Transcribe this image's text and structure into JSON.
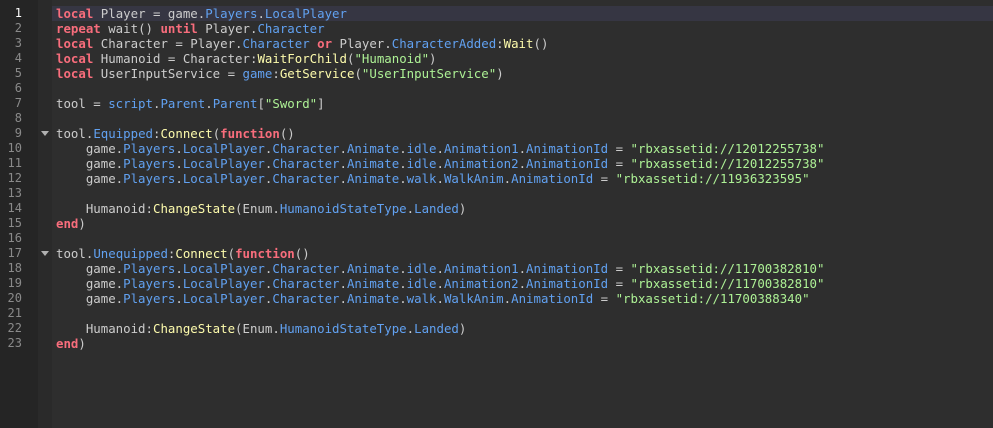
{
  "editor": {
    "current_line": 1,
    "colors": {
      "background": "#2e2e2e",
      "gutter": "#252525",
      "keyword": "#f86d7c",
      "identifier": "#cccccc",
      "property": "#61a1f1",
      "method": "#fdfbac",
      "string": "#adf195",
      "current_line": "#363643"
    },
    "lines": [
      {
        "num": "1",
        "tokens": [
          [
            "kw",
            "local"
          ],
          [
            "id",
            " Player = game."
          ],
          [
            "prop",
            "Players"
          ],
          [
            "id",
            "."
          ],
          [
            "prop",
            "LocalPlayer"
          ]
        ]
      },
      {
        "num": "2",
        "tokens": [
          [
            "kw",
            "repeat"
          ],
          [
            "id",
            " wait() "
          ],
          [
            "kw",
            "until"
          ],
          [
            "id",
            " Player."
          ],
          [
            "prop",
            "Character"
          ]
        ]
      },
      {
        "num": "3",
        "tokens": [
          [
            "kw",
            "local"
          ],
          [
            "id",
            " Character = Player."
          ],
          [
            "prop",
            "Character"
          ],
          [
            "id",
            " "
          ],
          [
            "kw",
            "or"
          ],
          [
            "id",
            " Player."
          ],
          [
            "prop",
            "CharacterAdded"
          ],
          [
            "id",
            ":"
          ],
          [
            "meth",
            "Wait"
          ],
          [
            "id",
            "()"
          ]
        ]
      },
      {
        "num": "4",
        "tokens": [
          [
            "kw",
            "local"
          ],
          [
            "id",
            " Humanoid = Character:"
          ],
          [
            "meth",
            "WaitForChild"
          ],
          [
            "id",
            "("
          ],
          [
            "str",
            "\"Humanoid\""
          ],
          [
            "id",
            ")"
          ]
        ]
      },
      {
        "num": "5",
        "tokens": [
          [
            "kw",
            "local"
          ],
          [
            "id",
            " UserInputService = "
          ],
          [
            "prop",
            "game"
          ],
          [
            "id",
            ":"
          ],
          [
            "meth",
            "GetService"
          ],
          [
            "id",
            "("
          ],
          [
            "str",
            "\"UserInputService\""
          ],
          [
            "id",
            ")"
          ]
        ]
      },
      {
        "num": "6",
        "tokens": []
      },
      {
        "num": "7",
        "tokens": [
          [
            "id",
            "tool = "
          ],
          [
            "prop",
            "script"
          ],
          [
            "id",
            "."
          ],
          [
            "prop",
            "Parent"
          ],
          [
            "id",
            "."
          ],
          [
            "prop",
            "Parent"
          ],
          [
            "id",
            "["
          ],
          [
            "str",
            "\"Sword\""
          ],
          [
            "id",
            "]"
          ]
        ]
      },
      {
        "num": "8",
        "tokens": []
      },
      {
        "num": "9",
        "fold": true,
        "tokens": [
          [
            "id",
            "tool."
          ],
          [
            "prop",
            "Equipped"
          ],
          [
            "id",
            ":"
          ],
          [
            "meth",
            "Connect"
          ],
          [
            "id",
            "("
          ],
          [
            "kw",
            "function"
          ],
          [
            "id",
            "()"
          ]
        ]
      },
      {
        "num": "10",
        "tokens": [
          [
            "id",
            "    game."
          ],
          [
            "prop",
            "Players"
          ],
          [
            "id",
            "."
          ],
          [
            "prop",
            "LocalPlayer"
          ],
          [
            "id",
            "."
          ],
          [
            "prop",
            "Character"
          ],
          [
            "id",
            "."
          ],
          [
            "prop",
            "Animate"
          ],
          [
            "id",
            "."
          ],
          [
            "prop",
            "idle"
          ],
          [
            "id",
            "."
          ],
          [
            "prop",
            "Animation1"
          ],
          [
            "id",
            "."
          ],
          [
            "prop",
            "AnimationId"
          ],
          [
            "id",
            " = "
          ],
          [
            "str",
            "\"rbxassetid://12012255738\""
          ]
        ]
      },
      {
        "num": "11",
        "tokens": [
          [
            "id",
            "    game."
          ],
          [
            "prop",
            "Players"
          ],
          [
            "id",
            "."
          ],
          [
            "prop",
            "LocalPlayer"
          ],
          [
            "id",
            "."
          ],
          [
            "prop",
            "Character"
          ],
          [
            "id",
            "."
          ],
          [
            "prop",
            "Animate"
          ],
          [
            "id",
            "."
          ],
          [
            "prop",
            "idle"
          ],
          [
            "id",
            "."
          ],
          [
            "prop",
            "Animation2"
          ],
          [
            "id",
            "."
          ],
          [
            "prop",
            "AnimationId"
          ],
          [
            "id",
            " = "
          ],
          [
            "str",
            "\"rbxassetid://12012255738\""
          ]
        ]
      },
      {
        "num": "12",
        "tokens": [
          [
            "id",
            "    game."
          ],
          [
            "prop",
            "Players"
          ],
          [
            "id",
            "."
          ],
          [
            "prop",
            "LocalPlayer"
          ],
          [
            "id",
            "."
          ],
          [
            "prop",
            "Character"
          ],
          [
            "id",
            "."
          ],
          [
            "prop",
            "Animate"
          ],
          [
            "id",
            "."
          ],
          [
            "prop",
            "walk"
          ],
          [
            "id",
            "."
          ],
          [
            "prop",
            "WalkAnim"
          ],
          [
            "id",
            "."
          ],
          [
            "prop",
            "AnimationId"
          ],
          [
            "id",
            " = "
          ],
          [
            "str",
            "\"rbxassetid://11936323595\""
          ]
        ]
      },
      {
        "num": "13",
        "tokens": []
      },
      {
        "num": "14",
        "tokens": [
          [
            "id",
            "    Humanoid:"
          ],
          [
            "meth",
            "ChangeState"
          ],
          [
            "id",
            "(Enum."
          ],
          [
            "prop",
            "HumanoidStateType"
          ],
          [
            "id",
            "."
          ],
          [
            "prop",
            "Landed"
          ],
          [
            "id",
            ")"
          ]
        ]
      },
      {
        "num": "15",
        "tokens": [
          [
            "kw",
            "end"
          ],
          [
            "id",
            ")"
          ]
        ]
      },
      {
        "num": "16",
        "tokens": []
      },
      {
        "num": "17",
        "fold": true,
        "tokens": [
          [
            "id",
            "tool."
          ],
          [
            "prop",
            "Unequipped"
          ],
          [
            "id",
            ":"
          ],
          [
            "meth",
            "Connect"
          ],
          [
            "id",
            "("
          ],
          [
            "kw",
            "function"
          ],
          [
            "id",
            "()"
          ]
        ]
      },
      {
        "num": "18",
        "tokens": [
          [
            "id",
            "    game."
          ],
          [
            "prop",
            "Players"
          ],
          [
            "id",
            "."
          ],
          [
            "prop",
            "LocalPlayer"
          ],
          [
            "id",
            "."
          ],
          [
            "prop",
            "Character"
          ],
          [
            "id",
            "."
          ],
          [
            "prop",
            "Animate"
          ],
          [
            "id",
            "."
          ],
          [
            "prop",
            "idle"
          ],
          [
            "id",
            "."
          ],
          [
            "prop",
            "Animation1"
          ],
          [
            "id",
            "."
          ],
          [
            "prop",
            "AnimationId"
          ],
          [
            "id",
            " = "
          ],
          [
            "str",
            "\"rbxassetid://11700382810\""
          ]
        ]
      },
      {
        "num": "19",
        "tokens": [
          [
            "id",
            "    game."
          ],
          [
            "prop",
            "Players"
          ],
          [
            "id",
            "."
          ],
          [
            "prop",
            "LocalPlayer"
          ],
          [
            "id",
            "."
          ],
          [
            "prop",
            "Character"
          ],
          [
            "id",
            "."
          ],
          [
            "prop",
            "Animate"
          ],
          [
            "id",
            "."
          ],
          [
            "prop",
            "idle"
          ],
          [
            "id",
            "."
          ],
          [
            "prop",
            "Animation2"
          ],
          [
            "id",
            "."
          ],
          [
            "prop",
            "AnimationId"
          ],
          [
            "id",
            " = "
          ],
          [
            "str",
            "\"rbxassetid://11700382810\""
          ]
        ]
      },
      {
        "num": "20",
        "tokens": [
          [
            "id",
            "    game."
          ],
          [
            "prop",
            "Players"
          ],
          [
            "id",
            "."
          ],
          [
            "prop",
            "LocalPlayer"
          ],
          [
            "id",
            "."
          ],
          [
            "prop",
            "Character"
          ],
          [
            "id",
            "."
          ],
          [
            "prop",
            "Animate"
          ],
          [
            "id",
            "."
          ],
          [
            "prop",
            "walk"
          ],
          [
            "id",
            "."
          ],
          [
            "prop",
            "WalkAnim"
          ],
          [
            "id",
            "."
          ],
          [
            "prop",
            "AnimationId"
          ],
          [
            "id",
            " = "
          ],
          [
            "str",
            "\"rbxassetid://11700388340\""
          ]
        ]
      },
      {
        "num": "21",
        "tokens": []
      },
      {
        "num": "22",
        "tokens": [
          [
            "id",
            "    Humanoid:"
          ],
          [
            "meth",
            "ChangeState"
          ],
          [
            "id",
            "(Enum."
          ],
          [
            "prop",
            "HumanoidStateType"
          ],
          [
            "id",
            "."
          ],
          [
            "prop",
            "Landed"
          ],
          [
            "id",
            ")"
          ]
        ]
      },
      {
        "num": "23",
        "tokens": [
          [
            "kw",
            "end"
          ],
          [
            "id",
            ")"
          ]
        ]
      }
    ]
  }
}
